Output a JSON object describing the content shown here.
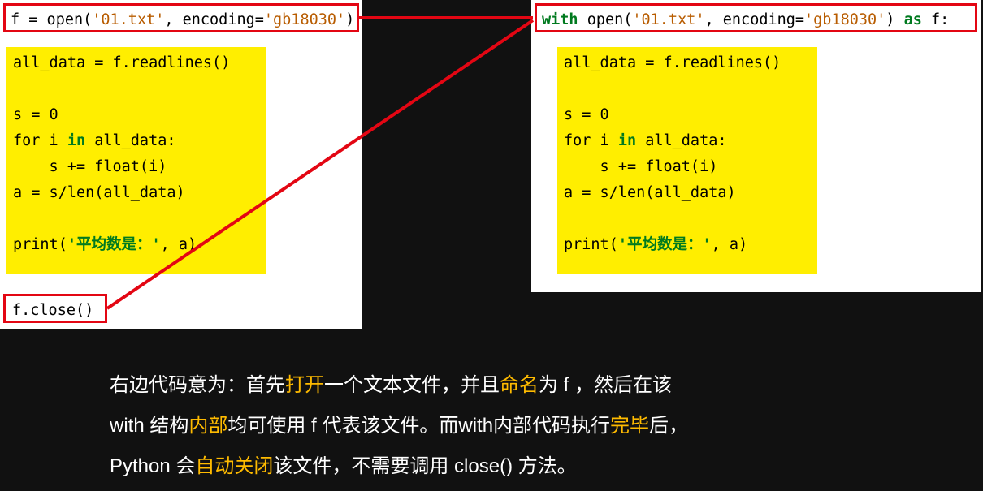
{
  "left": {
    "open_line": {
      "pre": "f = open(",
      "fn": "'01.txt'",
      "mid": ", encoding=",
      "enc": "'gb18030'",
      "post": ")"
    },
    "body": [
      "all_data = f.readlines()",
      "",
      "s = 0",
      {
        "pre": "for i ",
        "kw": "in",
        "post": " all_data:"
      },
      "    s += float(i)",
      "a = s/len(all_data)",
      "",
      {
        "type": "print",
        "pre": "print(",
        "str": "'平均数是：'",
        "post": ", a)"
      }
    ],
    "close": "f.close()"
  },
  "right": {
    "open_line": {
      "kw1": "with",
      "pre": " open(",
      "fn": "'01.txt'",
      "mid": ", encoding=",
      "enc": "'gb18030'",
      "post": ") ",
      "kw2": "as",
      "tail": " f:"
    },
    "body": [
      "all_data = f.readlines()",
      "",
      "s = 0",
      {
        "pre": "for i ",
        "kw": "in",
        "post": " all_data:"
      },
      "    s += float(i)",
      "a = s/len(all_data)",
      "",
      {
        "type": "print",
        "pre": "print(",
        "str": "'平均数是：'",
        "post": ", a)"
      }
    ]
  },
  "explain": {
    "p1a": "右边代码意为：首先",
    "p1b": "打开",
    "p1c": "一个文本文件，并且",
    "p1d": "命名",
    "p1e": "为 f ，然后在该",
    "p2a": "with 结构",
    "p2b": "内部",
    "p2c": "均可使用 f 代表该文件。而with内部代码执行",
    "p2d": "完毕",
    "p2e": "后，",
    "p3a": "Python 会",
    "p3b": "自动关闭",
    "p3c": "该文件，不需要调用 close()  方法。"
  }
}
